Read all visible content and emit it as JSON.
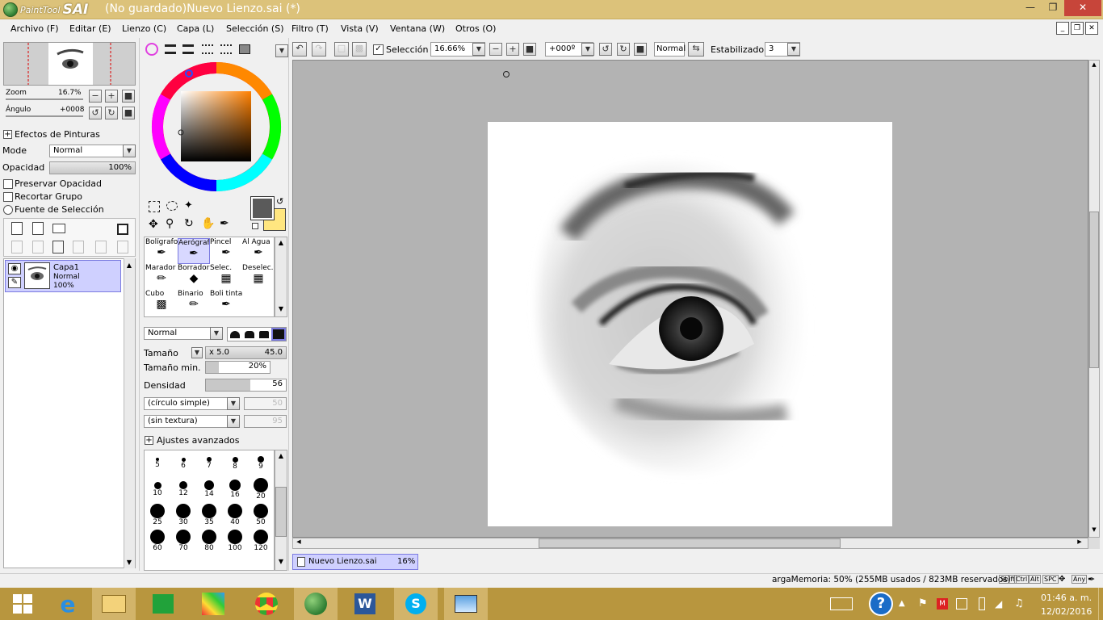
{
  "window": {
    "logo_small": "PaintTool",
    "logo_big": "SAI",
    "title": "(No guardado)Nuevo Lienzo.sai (*)"
  },
  "menu": [
    "Archivo (F)",
    "Editar (E)",
    "Lienzo (C)",
    "Capa (L)",
    "Selección (S)",
    "Filtro (T)",
    "Vista (V)",
    "Ventana (W)",
    "Otros (O)"
  ],
  "navigator": {
    "zoom_label": "Zoom",
    "zoom_value": "16.7%",
    "angle_label": "Ángulo",
    "angle_value": "+0008"
  },
  "layer_props": {
    "effects_label": "Efectos de Pinturas",
    "mode_label": "Mode",
    "mode_value": "Normal",
    "opacity_label": "Opacidad",
    "opacity_value": "100%",
    "opacity_fraction": 1.0,
    "preserve_label": "Preservar Opacidad",
    "clip_label": "Recortar Grupo",
    "source_label": "Fuente de Selección"
  },
  "layer1": {
    "name": "Capa1",
    "mode": "Normal",
    "opacity": "100%"
  },
  "tools": [
    [
      "Bolígrafo",
      "Aerógrafo",
      "Pincel",
      "Al Agua"
    ],
    [
      "Marador",
      "Borrador",
      "Selec.",
      "Deselec."
    ],
    [
      "Cubo",
      "Binario",
      "Boli tinta",
      ""
    ]
  ],
  "brush": {
    "blend_mode": "Normal",
    "size_label": "Tamaño",
    "size_multiplier": "x 5.0",
    "size_value": "45.0",
    "min_size_label": "Tamaño min.",
    "min_size_value": "20%",
    "min_size_fraction": 0.2,
    "density_label": "Densidad",
    "density_value": "56",
    "density_fraction": 0.56,
    "shape": "(círculo simple)",
    "shape_value": "50",
    "texture": "(sin textura)",
    "texture_value": "95",
    "advanced_label": "Ajustes avanzados"
  },
  "brush_sizes": [
    [
      "5",
      "6",
      "7",
      "8",
      "9"
    ],
    [
      "10",
      "12",
      "14",
      "16",
      "20"
    ],
    [
      "25",
      "30",
      "35",
      "40",
      "50"
    ],
    [
      "60",
      "70",
      "80",
      "100",
      "120"
    ]
  ],
  "toolbar": {
    "selection_label": "Selección",
    "zoom_value": "16.66%",
    "angle_value": "+000º",
    "blend_value": "Normal",
    "stabilizer_label": "Estabilizador",
    "stabilizer_value": "3"
  },
  "doc_tab": {
    "name": "Nuevo Lienzo.sai",
    "zoom": "16%"
  },
  "status": {
    "memory": "argaMemoria: 50% (255MB usados / 823MB reservados)",
    "keys": [
      "Shift",
      "Ctrl",
      "Alt",
      "SPC",
      "Any"
    ]
  },
  "taskbar": {
    "time": "01:46 a. m.",
    "date": "12/02/2016"
  },
  "colors": {
    "primary": "#5a5a5a",
    "secondary": "#ffe680",
    "accent_title": "#dcc27a",
    "taskbar": "#b8963e",
    "layer_sel": "#cfd0ff"
  }
}
